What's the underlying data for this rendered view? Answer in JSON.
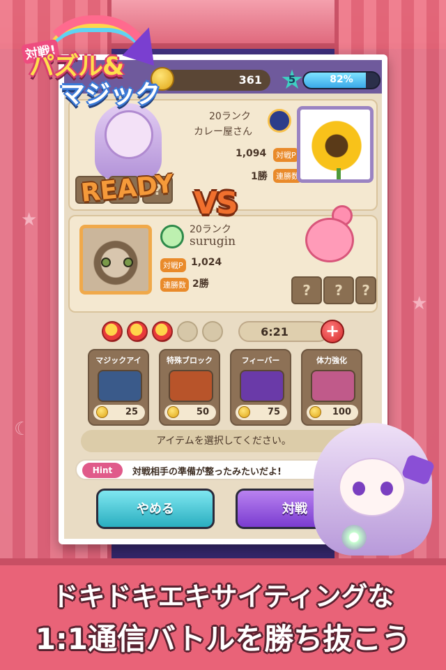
{
  "logo": {
    "tag": "対戦!",
    "line1": "パズル&",
    "line2": "マジック"
  },
  "topbar": {
    "coins": "361",
    "level": "5",
    "xp_percent": 82,
    "xp_label": "82%"
  },
  "opponent": {
    "rank": "20ランク",
    "name": "カレー屋さん",
    "battle_points": "1,094",
    "battle_points_tag": "対戦P",
    "wins": "1勝",
    "wins_tag": "連勝数",
    "ready_label": "READY",
    "slots": [
      "?",
      "?",
      "?"
    ]
  },
  "vs_label": "VS",
  "player": {
    "rank": "20ランク",
    "name": "surugin",
    "battle_points_tag": "対戦P",
    "battle_points": "1,024",
    "wins_tag": "連勝数",
    "wins": "2勝",
    "slots": [
      "?",
      "?",
      "?"
    ]
  },
  "stamina": {
    "filled": 3,
    "total": 5,
    "timer": "6:21",
    "plus_label": "+"
  },
  "items": [
    {
      "label": "マジックアイ",
      "cost": "25",
      "color": "#3a5a8a",
      "icon": "magnifier-icon"
    },
    {
      "label": "特殊ブロック",
      "cost": "50",
      "color": "#b8542a",
      "icon": "fire-block-icon"
    },
    {
      "label": "フィーバー",
      "cost": "75",
      "color": "#6a3aa8",
      "icon": "star-fever-icon"
    },
    {
      "label": "体力強化",
      "cost": "100",
      "color": "#c05a8a",
      "icon": "potion-icon"
    }
  ],
  "select_message": "アイテムを選択してください。",
  "hint": {
    "tag": "Hint",
    "text": "対戦相手の準備が整ったみたいだよ!"
  },
  "buttons": {
    "quit": "やめる",
    "battle": "対戦"
  },
  "banner": {
    "line1": "ドキドキエキサイティングな",
    "line2": "1:1通信バトルを勝ち抜こう"
  },
  "colors": {
    "accent_pink": "#e96378",
    "quit_btn": "#2aaec0",
    "battle_btn": "#7a3cd0"
  }
}
